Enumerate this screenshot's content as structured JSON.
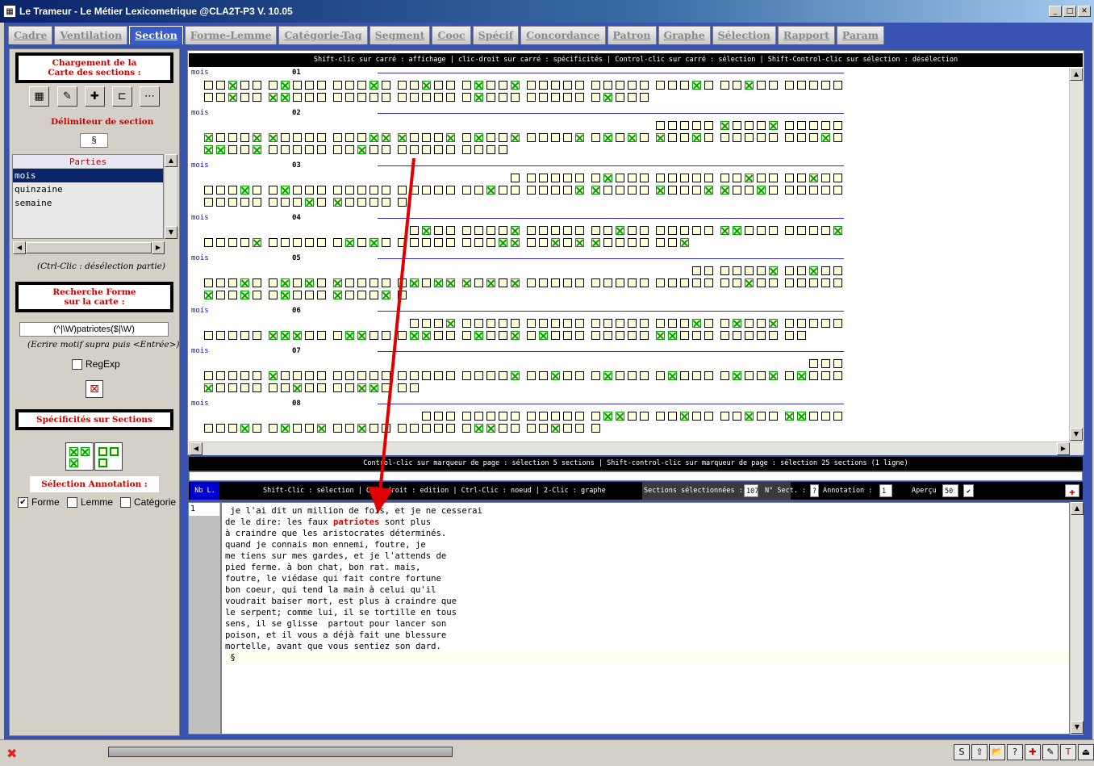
{
  "window": {
    "title": "Le Trameur - Le Métier Lexicometrique @CLA2T-P3 V. 10.05"
  },
  "tabs": [
    "Cadre",
    "Ventilation",
    "Section",
    "Forme-Lemme",
    "Catégorie-Tag",
    "Segment",
    "Cooc",
    "Spécif",
    "Concordance",
    "Patron",
    "Graphe",
    "Sélection",
    "Rapport",
    "Param"
  ],
  "left": {
    "load_title_1": "Chargement de la",
    "load_title_2": "Carte des sections :",
    "delim_label": "Délimiteur de section",
    "delim_value": "§",
    "parts_header": "Parties",
    "parts": [
      "mois",
      "quinzaine",
      "semaine"
    ],
    "parts_hint": "(Ctrl-Clic : désélection partie)",
    "search_title_1": "Recherche Forme",
    "search_title_2": "sur la carte :",
    "search_value": "(^|\\W)patriotes($|\\W)",
    "search_hint": "(Ecrire motif supra puis <Entrée>)",
    "regexp_label": "RegExp",
    "spec_title": "Spécificités sur Sections",
    "anno_title": "Sélection Annotation :",
    "forme_label": "Forme",
    "lemme_label": "Lemme",
    "categorie_label": "Catégorie"
  },
  "map": {
    "top_hint": "Shift-clic sur carré : affichage | clic-droit sur carré : spécificités | Control-clic sur carré : sélection | Shift-Control-clic sur sélection : désélection",
    "bottom_hint": "Control-clic sur marqueur de page : sélection 5 sections | Shift-control-clic sur marqueur de page : sélection 25 sections (1 ligne)",
    "sections": [
      {
        "label": "mois",
        "num": "01"
      },
      {
        "label": "mois",
        "num": "02"
      },
      {
        "label": "mois",
        "num": "03"
      },
      {
        "label": "mois",
        "num": "04"
      },
      {
        "label": "mois",
        "num": "05"
      },
      {
        "label": "mois",
        "num": "06"
      },
      {
        "label": "mois",
        "num": "07"
      },
      {
        "label": "mois",
        "num": "08"
      }
    ]
  },
  "annobar": {
    "nb_label": "Nb L.",
    "help": "Shift-Clic : sélection | Clic-droit : edition | Ctrl-Clic : noeud | 2-Clic : graphe",
    "sel_label": "Sections sélectionnées :",
    "sel_value": "107",
    "nsect_label": "N° Sect. :",
    "nsect_value": "?",
    "anno_label": "Annotation :",
    "anno_value": "1",
    "apercu_label": "Aperçu :",
    "apercu_value": "50"
  },
  "text": {
    "line_number": "1",
    "lines": [
      " je l'ai dit un million de fois, et je ne cesserai",
      "de le dire: les faux ",
      "à craindre que les aristocrates déterminés.",
      "quand je connais mon ennemi, foutre, je",
      "me tiens sur mes gardes, et je l'attends de",
      "pied ferme. à bon chat, bon rat. mais,",
      "foutre, le viédase qui fait contre fortune",
      "bon coeur, qui tend la main à celui qu'il",
      "voudrait baiser mort, est plus à craindre que",
      "le serpent; comme lui, il se tortille en tous",
      "sens, il se glisse  partout pour lancer son",
      "poison, et il vous a déjà fait une blessure",
      "mortelle, avant que vous sentiez son dard.",
      " §"
    ],
    "highlight": "patriotes",
    "after_highlight": " sont plus"
  },
  "status": {
    "close": "✖"
  }
}
